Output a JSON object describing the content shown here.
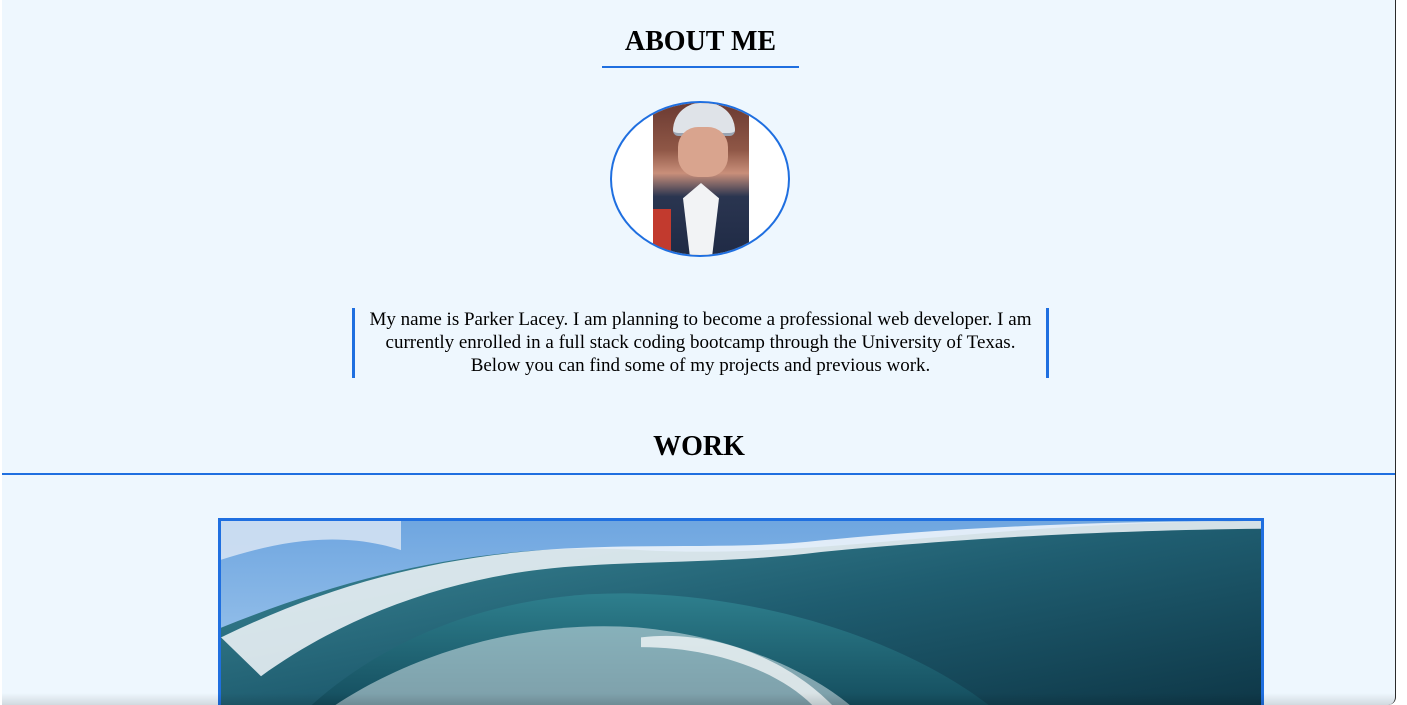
{
  "about": {
    "title": "ABOUT ME",
    "bio": "My name is Parker Lacey. I am planning to become a professional web developer. I am currently enrolled in a full stack coding bootcamp through the University of Texas. Below you can find some of my projects and previous work."
  },
  "work": {
    "title": "WORK"
  },
  "colors": {
    "background": "#eef7fe",
    "accent": "#1f6fe0",
    "text": "#000000"
  }
}
